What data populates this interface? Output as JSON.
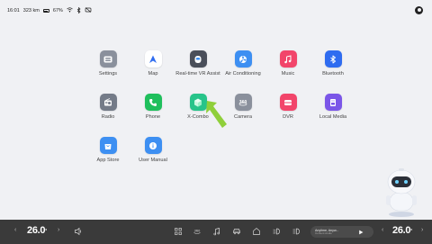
{
  "status": {
    "time": "16:01",
    "range": "323 km",
    "battery": "67%"
  },
  "apps": [
    {
      "id": "settings",
      "label": "Settings",
      "icon": "settings-icon",
      "color": "#8a909c"
    },
    {
      "id": "map",
      "label": "Map",
      "icon": "navigation-arrow-icon",
      "color": "#ffffff"
    },
    {
      "id": "vr",
      "label": "Real-time VR Assist",
      "icon": "robot-face-icon",
      "color": "#4a4f5a"
    },
    {
      "id": "air",
      "label": "Air Conditioning",
      "icon": "fan-icon",
      "color": "#3d8ff2"
    },
    {
      "id": "music",
      "label": "Music",
      "icon": "music-note-icon",
      "color": "#f2456a"
    },
    {
      "id": "bluetooth",
      "label": "Bluetooth",
      "icon": "bluetooth-icon",
      "color": "#2f6cf0"
    },
    {
      "id": "radio",
      "label": "Radio",
      "icon": "radio-icon",
      "color": "#747b88"
    },
    {
      "id": "phone",
      "label": "Phone",
      "icon": "phone-icon",
      "color": "#1fbf5c"
    },
    {
      "id": "xcombo",
      "label": "X-Combo",
      "icon": "cube-icon",
      "color": "#27c48a"
    },
    {
      "id": "camera",
      "label": "Camera",
      "icon": "camera-360-icon",
      "color": "#8a909c"
    },
    {
      "id": "dvr",
      "label": "DVR",
      "icon": "dvr-icon",
      "color": "#f2456a"
    },
    {
      "id": "localmedia",
      "label": "Local Media",
      "icon": "usb-drive-icon",
      "color": "#7b56e8"
    },
    {
      "id": "appstore",
      "label": "App Store",
      "icon": "shopping-bag-icon",
      "color": "#3d8ff2"
    },
    {
      "id": "manual",
      "label": "User Manual",
      "icon": "info-icon",
      "color": "#3d8ff2"
    }
  ],
  "taskbar": {
    "temp_left": "26.0",
    "temp_right": "26.0",
    "temp_unit": "°",
    "media_title": "Anytime, Anyw...",
    "media_subtitle": "Content Audio"
  },
  "colors": {
    "background": "#f0f1f4",
    "taskbar": "#3a3a3a",
    "arrow": "#8fcf3a"
  }
}
